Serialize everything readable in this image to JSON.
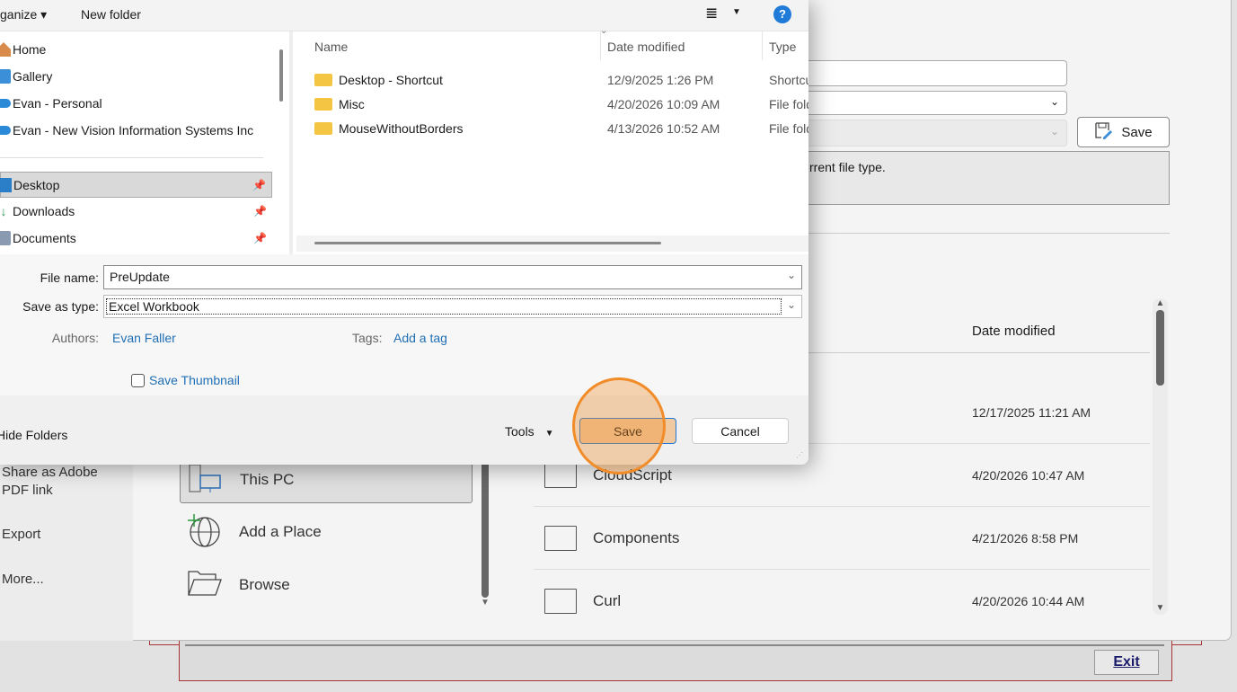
{
  "backstage": {
    "nav": [
      "Share as Adobe PDF link",
      "Export",
      "More..."
    ],
    "places": [
      {
        "label": "This PC",
        "icon": "this-pc-icon",
        "selected": true
      },
      {
        "label": "Add a Place",
        "icon": "globe-add-icon"
      },
      {
        "label": "Browse",
        "icon": "open-folder-icon"
      }
    ],
    "info_text": "rrent file type.",
    "save_label": "Save",
    "date_header": "Date modified",
    "files": [
      {
        "name": "",
        "date": "12/17/2025 11:21 AM"
      },
      {
        "name": "CloudScript",
        "date": "4/20/2026 10:47 AM"
      },
      {
        "name": "Components",
        "date": "4/21/2026 8:58 PM"
      },
      {
        "name": "Curl",
        "date": "4/20/2026 10:44 AM"
      }
    ]
  },
  "legacy": {
    "exit_label": "Exit"
  },
  "dialog": {
    "toolbar": {
      "organize": "ganize",
      "new_folder": "New folder",
      "help": "?"
    },
    "nav": [
      {
        "label": "Home",
        "icon": "home-icon"
      },
      {
        "label": "Gallery",
        "icon": "gallery-icon"
      },
      {
        "label": "Evan - Personal",
        "icon": "onedrive-icon"
      },
      {
        "label": "Evan - New Vision Information Systems Inc",
        "icon": "onedrive-icon"
      },
      {
        "label": "Desktop",
        "icon": "desktop-icon",
        "pinned": true,
        "selected": true
      },
      {
        "label": "Downloads",
        "icon": "download-icon",
        "pinned": true
      },
      {
        "label": "Documents",
        "icon": "documents-icon",
        "pinned": true
      }
    ],
    "columns": {
      "name": "Name",
      "date": "Date modified",
      "type": "Type"
    },
    "rows": [
      {
        "name": "Desktop - Shortcut",
        "date": "12/9/2025 1:26 PM",
        "type": "Shortcut"
      },
      {
        "name": "Misc",
        "date": "4/20/2026 10:09 AM",
        "type": "File folder"
      },
      {
        "name": "MouseWithoutBorders",
        "date": "4/13/2026 10:52 AM",
        "type": "File folder"
      }
    ],
    "file_name_label": "File name:",
    "file_name": "PreUpdate",
    "type_label": "Save as type:",
    "type_value": "Excel Workbook",
    "authors_label": "Authors:",
    "authors": "Evan Faller",
    "tags_label": "Tags:",
    "tags": "Add a tag",
    "thumbnail_label": "Save Thumbnail",
    "hide_folders": "Hide Folders",
    "tools": "Tools",
    "save": "Save",
    "cancel": "Cancel"
  },
  "colors": {
    "highlight": "#f28c28",
    "link": "#1f6fb5"
  }
}
